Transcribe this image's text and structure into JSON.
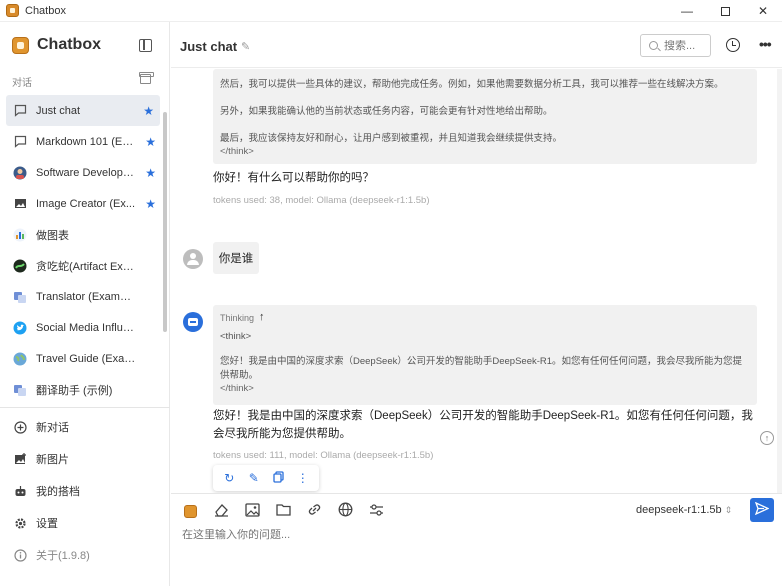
{
  "window": {
    "title": "Chatbox"
  },
  "sidebar": {
    "brand": "Chatbox",
    "section_label": "对话",
    "conversations": [
      {
        "label": "Just chat",
        "starred": true,
        "icon": "chat-bubble-icon"
      },
      {
        "label": "Markdown 101 (Ex...",
        "starred": true,
        "icon": "chat-bubble-icon"
      },
      {
        "label": "Software Develope...",
        "starred": true,
        "icon": "developer-avatar-icon"
      },
      {
        "label": "Image Creator (Ex...",
        "starred": true,
        "icon": "image-icon"
      },
      {
        "label": "做图表",
        "starred": false,
        "icon": "chart-icon"
      },
      {
        "label": "贪吃蛇(Artifact Example)",
        "starred": false,
        "icon": "snake-game-icon"
      },
      {
        "label": "Translator (Example)",
        "starred": false,
        "icon": "translator-avatar-icon"
      },
      {
        "label": "Social Media Influencer ...",
        "starred": false,
        "icon": "twitter-icon"
      },
      {
        "label": "Travel Guide (Example)",
        "starred": false,
        "icon": "globe-icon"
      },
      {
        "label": "翻译助手 (示例)",
        "starred": false,
        "icon": "translator-avatar-icon"
      }
    ],
    "menu": {
      "new_chat": "新对话",
      "new_image": "新图片",
      "my_copilots": "我的搭档",
      "settings": "设置",
      "about": "关于(1.9.8)"
    }
  },
  "header": {
    "chat_title": "Just chat",
    "search_placeholder": "搜索..."
  },
  "messages": {
    "first_think": {
      "p1": "然后，我可以提供一些具体的建议，帮助他完成任务。例如，如果他需要数据分析工具，我可以推荐一些在线解决方案。",
      "p2": "另外，如果我能确认他的当前状态或任务内容，可能会更有针对性地给出帮助。",
      "p3": "最后，我应该保持友好和耐心，让用户感到被重视，并且知道我会继续提供支持。",
      "close_tag": "</think>"
    },
    "first_reply": "你好！有什么可以帮助你的吗？",
    "first_meta": "tokens used: 38, model: Ollama (deepseek-r1:1.5b)",
    "user_message": "你是谁",
    "thinking_label": "Thinking",
    "second_think": {
      "open_tag": "<think>",
      "body": "您好！我是由中国的深度求索（DeepSeek）公司开发的智能助手DeepSeek-R1。如您有任何任何问题，我会尽我所能为您提供帮助。",
      "close_tag": "</think>"
    },
    "second_reply": "您好！我是由中国的深度求索（DeepSeek）公司开发的智能助手DeepSeek-R1。如您有任何任何问题，我会尽我所能为您提供帮助。",
    "second_meta": "tokens used: 111, model: Ollama (deepseek-r1:1.5b)"
  },
  "input": {
    "model": "deepseek-r1:1.5b",
    "placeholder": "在这里输入你的问题..."
  },
  "colors": {
    "accent": "#2a6fdb",
    "active_item_bg": "#e9ecf1",
    "bubble_bg": "#f1f1f1"
  }
}
